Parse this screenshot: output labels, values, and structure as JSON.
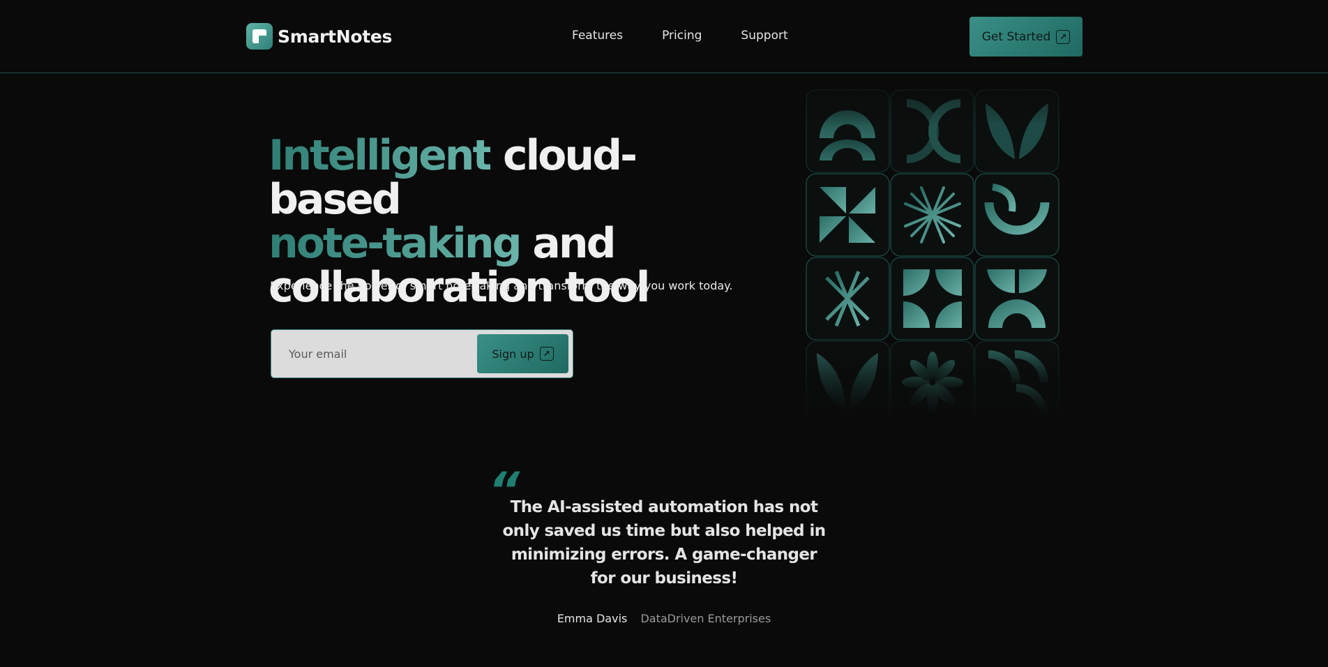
{
  "brand": {
    "name": "SmartNotes",
    "logo_icon": "note-icon",
    "accent_color": "#2f8a80"
  },
  "nav": {
    "items": [
      {
        "label": "Features"
      },
      {
        "label": "Pricing"
      },
      {
        "label": "Support"
      }
    ]
  },
  "header": {
    "cta_label": "Get Started",
    "cta_icon": "arrow-up-right-icon"
  },
  "hero": {
    "title_accent_1": "Intelligent",
    "title_1": "cloud-based",
    "title_accent_2": "note-taking",
    "title_2": "and",
    "title_3": "collaboration tool",
    "subtitle": "Experience the power of smart note-taking and transform the way you work today.",
    "email_placeholder": "Your email",
    "signup_label": "Sign up",
    "signup_icon": "arrow-up-right-icon"
  },
  "pattern": {
    "tiles": [
      "arch-icon",
      "crescent-icon",
      "leaf-pair-icon",
      "pinwheel-icon",
      "starburst-icon",
      "cup-icon",
      "starburst-icon",
      "four-petal-icon",
      "split-arch-icon",
      "leaf-pair-icon",
      "flower-icon",
      "quarter-arcs-icon"
    ]
  },
  "testimonial": {
    "quote_mark": "“",
    "quote": "The AI-assisted automation has not only saved us time but also helped in minimizing errors. A game-changer for our business!",
    "name": "Emma Davis",
    "company": "DataDriven Enterprises"
  }
}
